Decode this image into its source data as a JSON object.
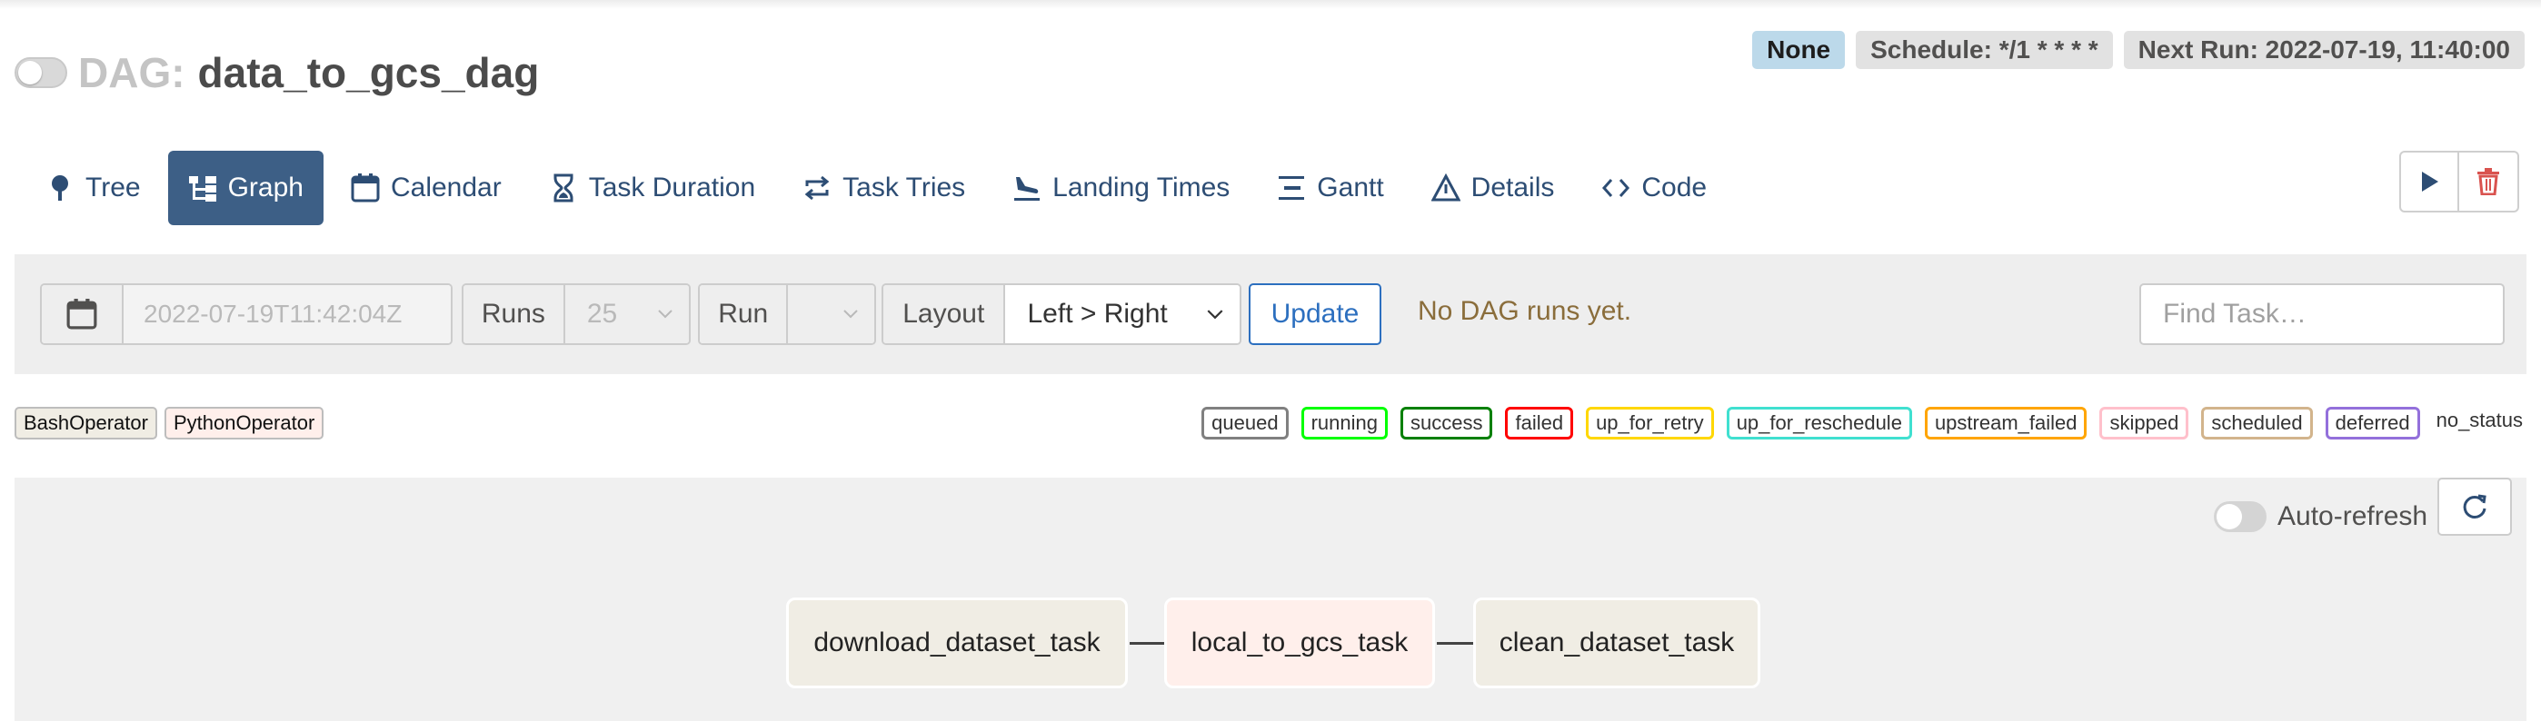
{
  "header": {
    "dag_prefix": "DAG:",
    "dag_name": "data_to_gcs_dag",
    "badges": {
      "status": "None",
      "schedule": "Schedule: */1 * * * *",
      "next_run": "Next Run: 2022-07-19, 11:40:00"
    }
  },
  "tabs": [
    {
      "label": "Tree",
      "icon": "tree-icon",
      "active": false
    },
    {
      "label": "Graph",
      "icon": "graph-icon",
      "active": true
    },
    {
      "label": "Calendar",
      "icon": "calendar-icon",
      "active": false
    },
    {
      "label": "Task Duration",
      "icon": "hourglass-icon",
      "active": false
    },
    {
      "label": "Task Tries",
      "icon": "repeat-icon",
      "active": false
    },
    {
      "label": "Landing Times",
      "icon": "plane-landing-icon",
      "active": false
    },
    {
      "label": "Gantt",
      "icon": "gantt-icon",
      "active": false
    },
    {
      "label": "Details",
      "icon": "warning-triangle-icon",
      "active": false
    },
    {
      "label": "Code",
      "icon": "code-icon",
      "active": false
    }
  ],
  "filters": {
    "date_value": "2022-07-19T11:42:04Z",
    "runs_label": "Runs",
    "runs_value": "25",
    "run_label": "Run",
    "run_value": "",
    "layout_label": "Layout",
    "layout_value": "Left > Right",
    "update_label": "Update",
    "message": "No DAG runs yet.",
    "find_task_placeholder": "Find Task…"
  },
  "operators": [
    "BashOperator",
    "PythonOperator"
  ],
  "operator_colors": [
    "#f0ede4",
    "#ffefeb"
  ],
  "legend": [
    {
      "label": "queued",
      "color": "#808080"
    },
    {
      "label": "running",
      "color": "#00ff00"
    },
    {
      "label": "success",
      "color": "#008000"
    },
    {
      "label": "failed",
      "color": "#ff0000"
    },
    {
      "label": "up_for_retry",
      "color": "#ffd700"
    },
    {
      "label": "up_for_reschedule",
      "color": "#40e0d0"
    },
    {
      "label": "upstream_failed",
      "color": "#ffa500"
    },
    {
      "label": "skipped",
      "color": "#ffc0cb"
    },
    {
      "label": "scheduled",
      "color": "#d2b48c"
    },
    {
      "label": "deferred",
      "color": "#9370db"
    },
    {
      "label": "no_status",
      "color": ""
    }
  ],
  "graph": {
    "auto_refresh_label": "Auto-refresh",
    "nodes": [
      {
        "label": "download_dataset_task",
        "color": "#f0ede4"
      },
      {
        "label": "local_to_gcs_task",
        "color": "#ffefeb"
      },
      {
        "label": "clean_dataset_task",
        "color": "#f0ede4"
      }
    ]
  }
}
